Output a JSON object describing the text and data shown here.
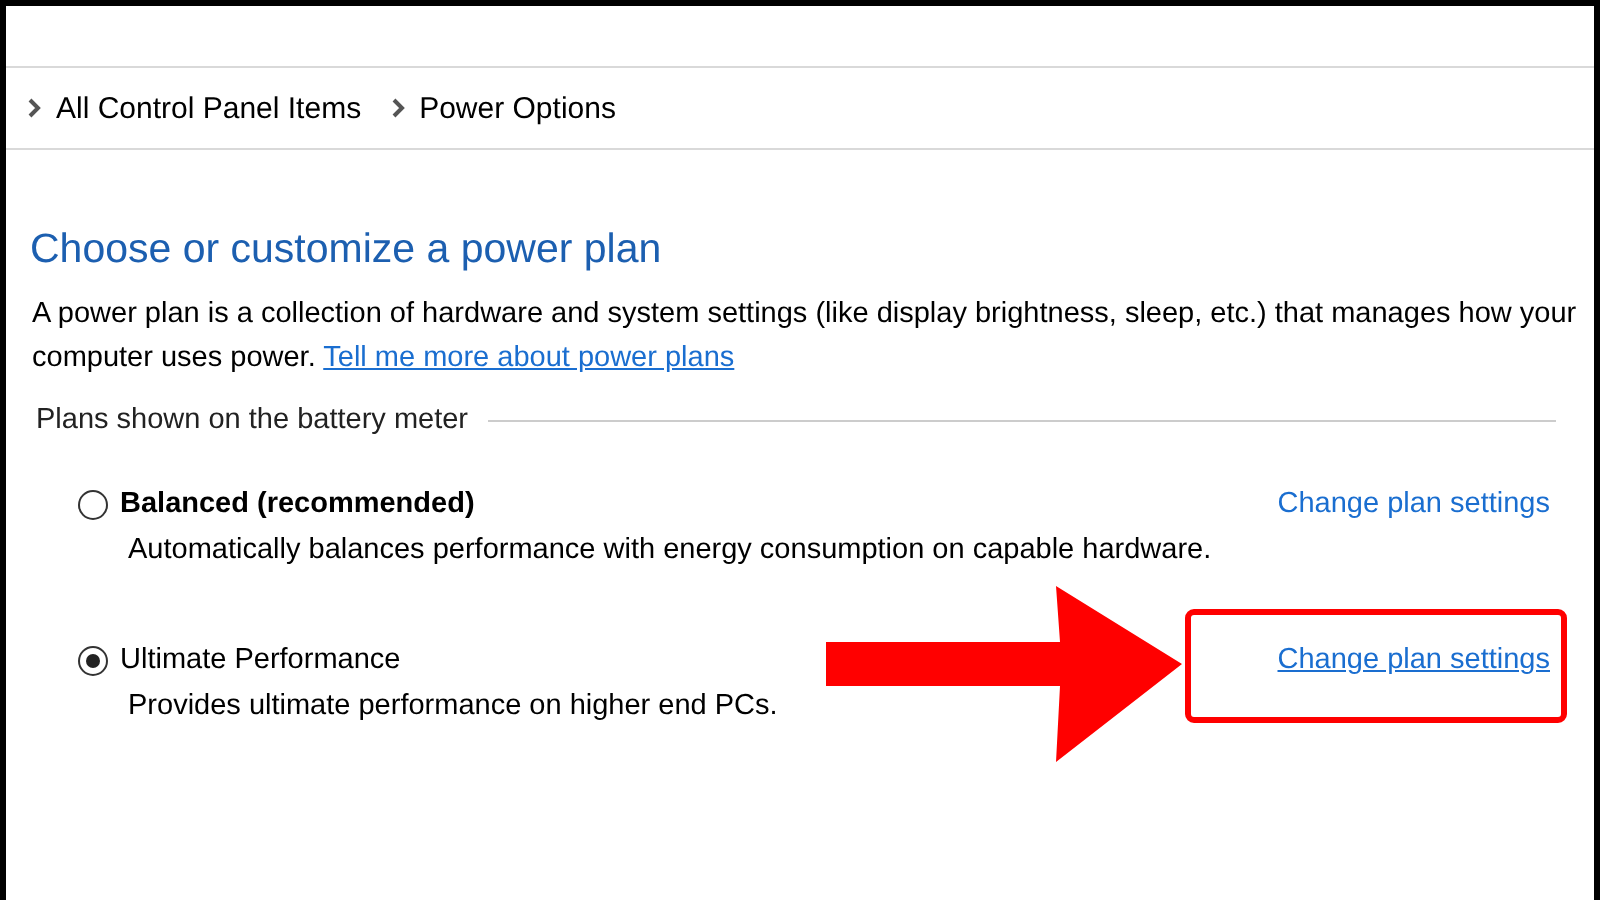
{
  "breadcrumb": [
    "All Control Panel Items",
    "Power Options"
  ],
  "title": "Choose or customize a power plan",
  "intro": {
    "text": "A power plan is a collection of hardware and system settings (like display brightness, sleep, etc.) that manages how your computer uses power.",
    "link": "Tell me more about power plans"
  },
  "group_label": "Plans shown on the battery meter",
  "plans": [
    {
      "name": "Balanced (recommended)",
      "description": "Automatically balances performance with energy consumption on capable hardware.",
      "link": "Change plan settings",
      "selected": false,
      "bold": true,
      "hovered": false
    },
    {
      "name": "Ultimate Performance",
      "description": "Provides ultimate performance on higher end PCs.",
      "link": "Change plan settings",
      "selected": true,
      "bold": false,
      "hovered": true
    }
  ]
}
